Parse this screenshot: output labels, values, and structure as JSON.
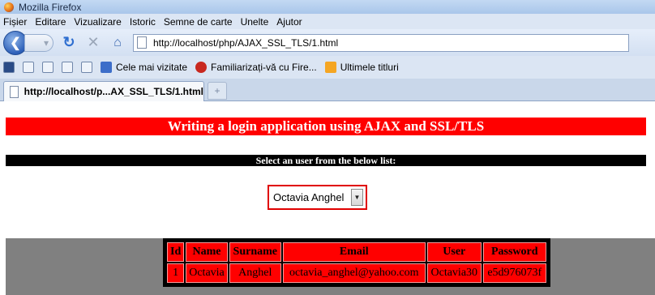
{
  "window": {
    "title": "Mozilla Firefox"
  },
  "menu": [
    "Fișier",
    "Editare",
    "Vizualizare",
    "Istoric",
    "Semne de carte",
    "Unelte",
    "Ajutor"
  ],
  "navigation": {
    "url": "http://localhost/php/AJAX_SSL_TLS/1.html"
  },
  "bookmarks": {
    "items": [
      {
        "label": "Cele mai vizitate",
        "icon": "most-visited-icon"
      },
      {
        "label": "Familiarizați-vă cu Fire...",
        "icon": "firefox-getting-started-icon"
      },
      {
        "label": "Ultimele titluri",
        "icon": "rss-icon"
      }
    ]
  },
  "tab": {
    "title": "http://localhost/p...AX_SSL_TLS/1.html",
    "new_tab": "+"
  },
  "page": {
    "banner": "Writing a login application using AJAX and SSL/TLS",
    "subtitle": "Select an user from the below list:",
    "selected_user": "Octavia Anghel",
    "table": {
      "headers": [
        "Id",
        "Name",
        "Surname",
        "Email",
        "User",
        "Password"
      ],
      "rows": [
        [
          "1",
          "Octavia",
          "Anghel",
          "octavia_anghel@yahoo.com",
          "Octavia30",
          "e5d976073f"
        ]
      ]
    }
  },
  "colors": {
    "banner": "#ff0000",
    "subtitle_bg": "#000000",
    "table_bg": "#808080"
  }
}
